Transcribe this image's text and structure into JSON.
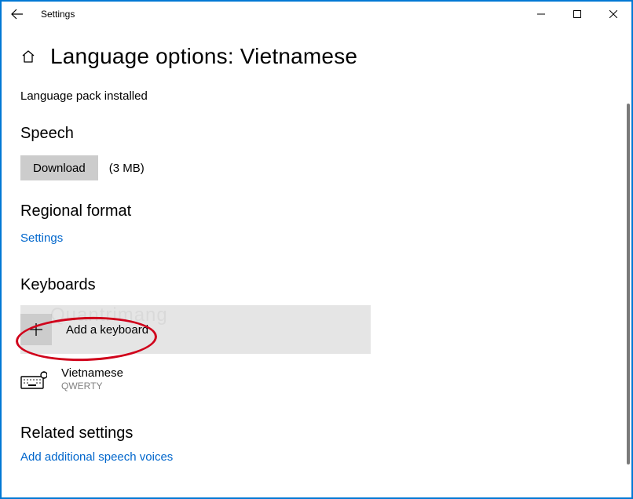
{
  "window": {
    "title": "Settings"
  },
  "page": {
    "title": "Language options: Vietnamese",
    "status": "Language pack installed"
  },
  "speech": {
    "heading": "Speech",
    "download_label": "Download",
    "size": "(3 MB)"
  },
  "regional": {
    "heading": "Regional format",
    "link": "Settings"
  },
  "keyboards": {
    "heading": "Keyboards",
    "add_label": "Add a keyboard",
    "items": [
      {
        "name": "Vietnamese",
        "layout": "QWERTY"
      }
    ]
  },
  "related": {
    "heading": "Related settings",
    "link": "Add additional speech voices"
  },
  "watermark": "Quantrimang"
}
